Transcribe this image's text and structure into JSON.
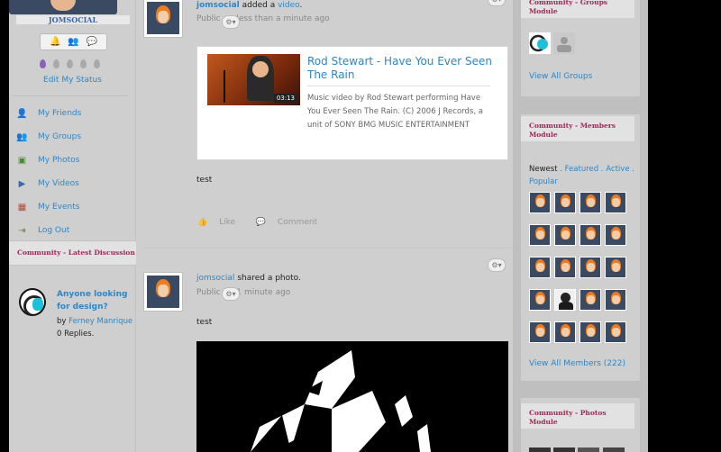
{
  "profile": {
    "username": "JOMSOCIAL",
    "edit_status": "Edit My Status"
  },
  "sidebar_menu": [
    {
      "label": "My Friends",
      "icon": "user-icon"
    },
    {
      "label": "My Groups",
      "icon": "users-icon"
    },
    {
      "label": "My Photos",
      "icon": "photo-icon"
    },
    {
      "label": "My Videos",
      "icon": "video-icon"
    },
    {
      "label": "My Events",
      "icon": "calendar-icon"
    },
    {
      "label": "Log Out",
      "icon": "logout-icon"
    }
  ],
  "latest_discussion": {
    "heading": "Community - Latest Discussion",
    "title": "Anyone looking for design?",
    "by": "by",
    "author": "Ferney Manrique",
    "replies": "0 Replies."
  },
  "stream": {
    "post1": {
      "actor": "jomsocial",
      "verb": "added a",
      "object": "video",
      "privacy": "Public",
      "time": "less than a minute ago",
      "video_title": "Rod Stewart - Have You Ever Seen The Rain",
      "video_duration": "03:13",
      "video_desc": "Music video by Rod Stewart performing Have You Ever Seen The Rain. (C) 2006 J Records, a unit of SONY BMG MUSIC ENTERTAINMENT",
      "message": "test",
      "like": "Like",
      "comment": "Comment"
    },
    "post2": {
      "actor": "jomsocial",
      "verb": "shared a photo.",
      "privacy": "Public",
      "time": "1 minute ago",
      "message": "test"
    }
  },
  "groups_module": {
    "heading": "Community - Groups Module",
    "view_all": "View All Groups"
  },
  "members_module": {
    "heading": "Community - Members Module",
    "tab_newest": "Newest",
    "tab_featured": "Featured",
    "tab_active": "Active",
    "tab_popular": "Popular",
    "view_all": "View All Members (222)"
  },
  "photos_module": {
    "heading": "Community - Photos Module"
  },
  "colors": {
    "link": "#2e86c8",
    "module_heading": "#9c2a58",
    "panel_bg": "#cfcfcf"
  }
}
